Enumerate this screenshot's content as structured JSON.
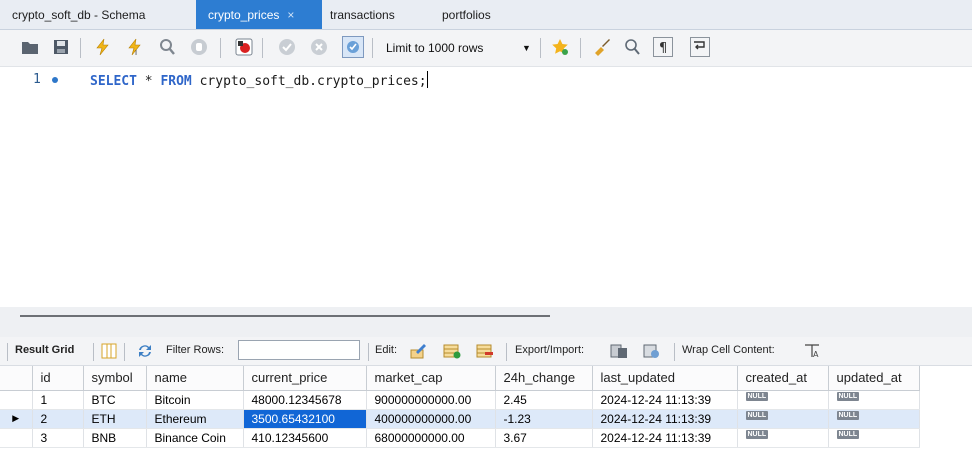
{
  "tabs": [
    {
      "label": "crypto_soft_db - Schema",
      "active": false
    },
    {
      "label": "crypto_prices",
      "active": true
    },
    {
      "label": "transactions",
      "active": false
    },
    {
      "label": "portfolios",
      "active": false
    }
  ],
  "tab_close": "×",
  "toolbar": {
    "limit_label": "Limit to 1000 rows",
    "limit_arrow": "▼"
  },
  "editor": {
    "line_number": "1",
    "kw_select": "SELECT",
    "star": "*",
    "kw_from": "FROM",
    "table_ref": "crypto_soft_db.crypto_prices;"
  },
  "result_toolbar": {
    "result_grid": "Result Grid",
    "filter_rows": "Filter Rows:",
    "edit": "Edit:",
    "export_import": "Export/Import:",
    "wrap_cell": "Wrap Cell Content:"
  },
  "grid": {
    "columns": [
      "id",
      "symbol",
      "name",
      "current_price",
      "market_cap",
      "24h_change",
      "last_updated",
      "created_at",
      "updated_at"
    ],
    "null_label": "NULL",
    "row_marker": "▶",
    "rows": [
      [
        "1",
        "BTC",
        "Bitcoin",
        "48000.12345678",
        "900000000000.00",
        "2.45",
        "2024-12-24 11:13:39"
      ],
      [
        "2",
        "ETH",
        "Ethereum",
        "3500.65432100",
        "400000000000.00",
        "-1.23",
        "2024-12-24 11:13:39"
      ],
      [
        "3",
        "BNB",
        "Binance Coin",
        "410.12345600",
        "68000000000.00",
        "3.67",
        "2024-12-24 11:13:39"
      ]
    ]
  }
}
